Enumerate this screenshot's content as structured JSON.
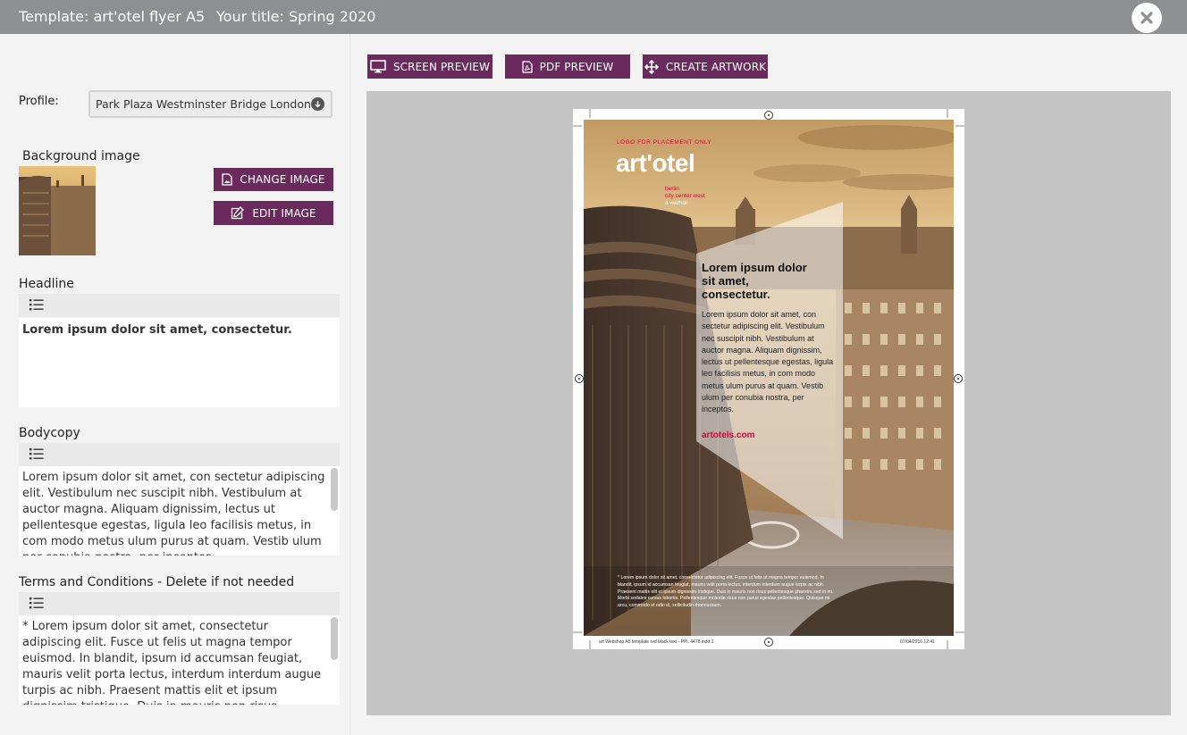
{
  "header": {
    "template_label": "Template: art'otel flyer A5",
    "title_label": "Your title: Spring 2020"
  },
  "left": {
    "profile_label": "Profile:",
    "profile_value": "Park Plaza Westminster Bridge London",
    "background_label": "Background image",
    "change_image": "CHANGE IMAGE",
    "edit_image": "EDIT IMAGE",
    "headline_label": "Headline",
    "headline_text": "Lorem ipsum dolor  sit amet, consectetur.",
    "bodycopy_label": "Bodycopy",
    "bodycopy_text": "Lorem ipsum dolor sit amet, con sectetur adipiscing elit. Vestibulum nec suscipit nibh. Vestibulum at auctor magna. Aliquam dignissim, lectus ut pellentesque egestas, ligula leo facilisis metus, in com modo metus ulum purus at quam. Vestib ulum per conubia nostra, per inceptos.",
    "terms_label": "Terms and Conditions - Delete if not needed",
    "terms_text": "* Lorem ipsum dolor sit amet, consectetur adipiscing elit. Fusce ut felis ut magna tempor euismod. In blandit, ipsum id accumsan feugiat, mauris velit porta lectus, interdum interdum augue turpis ac nibh. Praesent mattis elit et ipsum dignissim tristique. Duis in mauris non risus pellentesque pharetra sed in mi. Morbi"
  },
  "preview": {
    "screen_preview": "SCREEN PREVIEW",
    "pdf_preview": "PDF PREVIEW",
    "create_artwork": "CREATE ARTWORK"
  },
  "flyer": {
    "logo_note": "LOGO FOR PLACEMENT ONLY",
    "brand": "art'otel",
    "location_line1": "berlin",
    "location_line2": "city center west",
    "location_line3": "a warhol",
    "headline_l1": "Lorem ipsum dolor",
    "headline_l2": "sit amet,",
    "headline_l3": "consectetur.",
    "body": "Lorem ipsum dolor sit amet, con sectetur adipiscing elit. Vestibulum nec suscipit nibh. Vestibulum at auctor magna. Aliquam dignissim, lectus ut pellentesque egestas, ligula leo facilisis metus, in com modo metus ulum purus at quam. Vestib ulum per conubia nostra, per inceptos.",
    "website": "artotels.com",
    "terms": "* Lorem ipsum dolor sit amet, consectetur adipiscing elit. Fusce ut felis ut magna tempor euismod. In blandit, ipsum id accumsan feugiat, mauris velit porta lectus, interdum interdum augue turpis ac nibh. Praesent mattis elit et ipsum dignissim tristique. Duis in mauris non risus pellentesque pharetra sed in mi. Morbi sodales cursus lobortis. Pellentesque molestie risus non purus egestas pellentesque. Quisque mi arcu, commodo et odio id, sollicitudin rhoncussum.",
    "slug_left": "art Webshop A5 template red black text - PPL 4478.indd   1",
    "slug_right": "07/04/2016   12:41"
  },
  "colors": {
    "accent_purple": "#6a2a5e",
    "header_grey": "#8e8f91",
    "brand_red": "#e2003d"
  },
  "icons": [
    "close-icon",
    "dropdown-arrow-icon",
    "image-file-icon",
    "edit-icon",
    "list-icon",
    "monitor-icon",
    "pdf-icon",
    "move-arrows-icon",
    "registration-mark-icon"
  ]
}
